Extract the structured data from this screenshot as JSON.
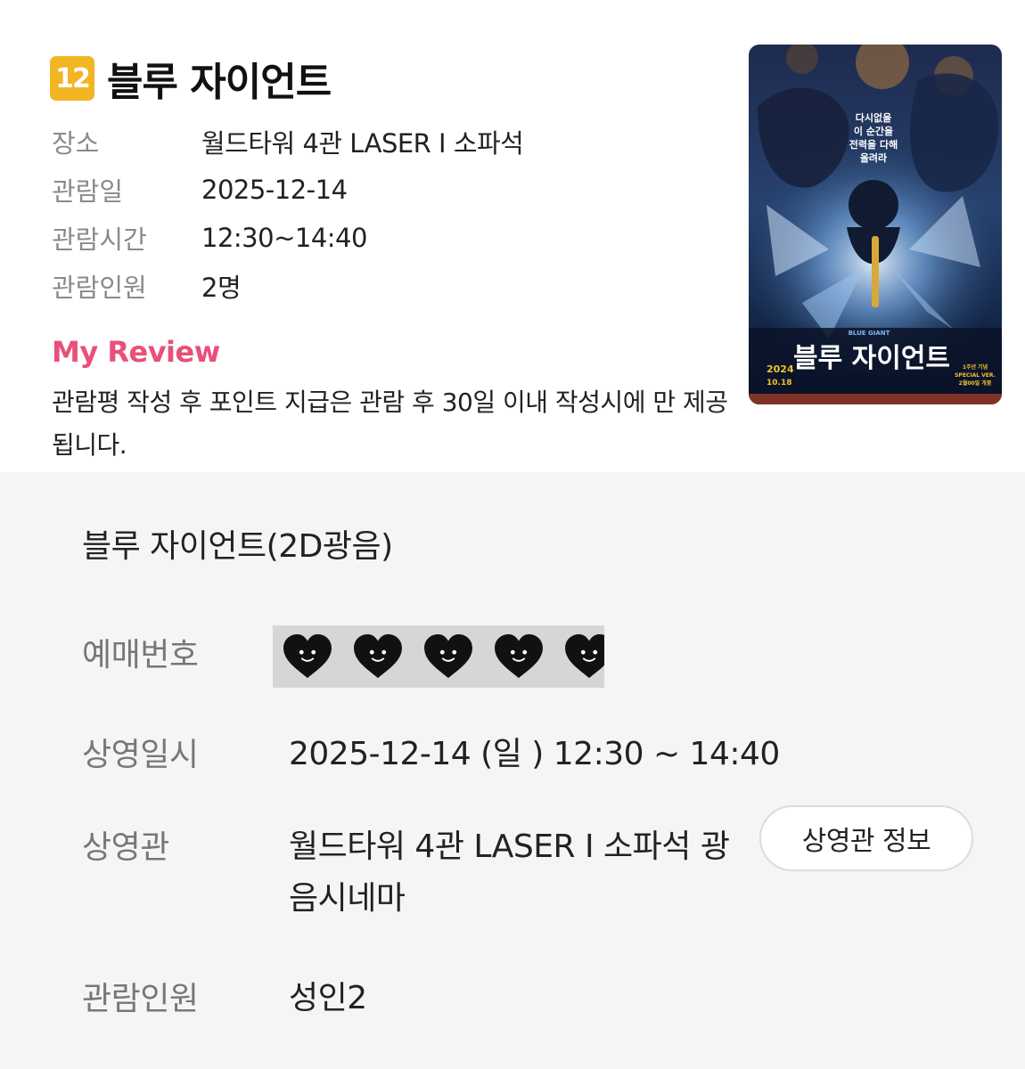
{
  "header": {
    "rating": "12",
    "title": "블루 자이언트"
  },
  "info": [
    {
      "label": "장소",
      "value": "월드타워 4관 LASER I 소파석"
    },
    {
      "label": "관람일",
      "value": "2025-12-14"
    },
    {
      "label": "관람시간",
      "value": "12:30~14:40"
    },
    {
      "label": "관람인원",
      "value": "2명"
    }
  ],
  "review": {
    "title": "My Review",
    "notice": "관람평 작성 후 포인트 지급은 관람 후 30일 이내 작성시에 만 제공됩니다."
  },
  "poster": {
    "tagline": [
      "다시없을",
      "이 순간을",
      "전력을 다해",
      "올려라"
    ],
    "logo_small": "BLUE GIANT",
    "logo": "블루 자이언트",
    "year": "2024",
    "date": "10.18",
    "edition": [
      "1주년 기념",
      "SPECIAL VER.",
      "2월00일 개봉"
    ]
  },
  "booking": {
    "title": "블루 자이언트(2D광음)",
    "reservation_label": "예매번호",
    "showtime_label": "상영일시",
    "showtime_value": "2025-12-14 (일 ) 12:30 ~ 14:40",
    "theater_label": "상영관",
    "theater_value_line1": "월드타워 4관 LASER I 소파석 광",
    "theater_value_line2": "음시네마",
    "theater_button": "상영관 정보",
    "people_label": "관람인원",
    "people_value": "성인2"
  },
  "colors": {
    "rating_badge": "#f2b523",
    "review_accent": "#e8507a",
    "bottom_bg": "#f5f5f5"
  }
}
